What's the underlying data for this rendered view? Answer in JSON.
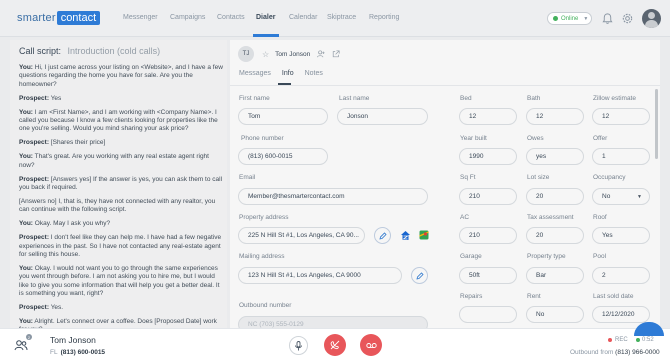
{
  "brand": {
    "part1": "smarter",
    "part2": "contact",
    "accent": "#2e7bd6"
  },
  "nav": {
    "items": [
      "Messenger",
      "Campaigns",
      "Contacts",
      "Dialer",
      "Calendar",
      "Skiptrace",
      "Reporting"
    ],
    "active": "Dialer",
    "status": "Online",
    "icons": [
      "bell-icon",
      "gear-icon",
      "user-avatar"
    ]
  },
  "script": {
    "title": "Call script:",
    "subtitle": "Introduction (cold calls)",
    "paragraphs": [
      {
        "speaker": "You:",
        "text": "Hi, I just came across your listing on <Website>, and I have a few questions regarding the home you have for sale. Are you the homeowner?"
      },
      {
        "speaker": "Prospect:",
        "text": "Yes"
      },
      {
        "speaker": "You:",
        "text": "I am <First Name>, and I am working with <Company Name>. I called you because I know a few clients looking for properties like the one you're selling. Would you mind sharing your ask price?"
      },
      {
        "speaker": "Prospect:",
        "text": "[Shares their price]"
      },
      {
        "speaker": "You:",
        "text": "That's great. Are you working with any real estate agent right now?"
      },
      {
        "speaker": "Prospect:",
        "text": "[Answers yes] If the answer is yes, you can ask them to call you back if required."
      },
      {
        "speaker": "",
        "text": "[Answers no] I, that is, they have not connected with any realtor, you can continue with the following script."
      },
      {
        "speaker": "You:",
        "text": "Okay. May I ask you why?"
      },
      {
        "speaker": "Prospect:",
        "text": "I don't feel like they can help me. I have had a few negative experiences in the past. So I have not contacted any real-estate agent for selling this house."
      },
      {
        "speaker": "You:",
        "text": "Okay. I would not want you to go through the same experiences you went through before. I am not asking you to hire me, but I would like to give you some information that will help you get a better deal. It is something you want, right?"
      },
      {
        "speaker": "Prospect:",
        "text": "Yes."
      },
      {
        "speaker": "You:",
        "text": "Alright. Let's connect over a coffee. Does [Proposed Date] work for you?"
      }
    ]
  },
  "contact": {
    "initials": "TJ",
    "name": "Tom Jonson",
    "tabs": [
      "Messages",
      "Info",
      "Notes"
    ],
    "active_tab": "Info",
    "first_name_label": "First name",
    "first_name": "Tom",
    "last_name_label": "Last name",
    "last_name": "Jonson",
    "phone_label": "Phone number",
    "phone": "(813) 600-0015",
    "email_label": "Email",
    "email": "Member@thesmartercontact.com",
    "property_label": "Property address",
    "property": "225 N Hill St #1, Los Angeles, CA 90...",
    "mailing_label": "Mailing address",
    "mailing": "123 N Hill St #1, Los Angeles, CA 9000",
    "outbound_label": "Outbound number",
    "outbound_placeholder": "NC (703) 555-0129",
    "bed_label": "Bed",
    "bed": "12",
    "bath_label": "Bath",
    "bath": "12",
    "zillow_label": "Zillow estimate",
    "zillow": "12",
    "year_label": "Year built",
    "year": "1990",
    "owes_label": "Owes",
    "owes": "yes",
    "offer_label": "Offer",
    "offer": "1",
    "sqft_label": "Sq Ft",
    "sqft": "210",
    "lot_label": "Lot size",
    "lot": "20",
    "occupancy_label": "Occupancy",
    "occupancy": "No",
    "ac_label": "AC",
    "ac": "210",
    "tax_label": "Tax assessment",
    "tax": "20",
    "roof_label": "Roof",
    "roof": "Yes",
    "garage_label": "Garage",
    "garage": "50ft",
    "ptype_label": "Property type",
    "ptype": "Bar",
    "pool_label": "Pool",
    "pool": "2",
    "repairs_label": "Repairs",
    "repairs": "",
    "rent_label": "Rent",
    "rent": "No",
    "lastsold_label": "Last sold date",
    "lastsold": "12/12/2020"
  },
  "callbar": {
    "badge": "2",
    "name": "Tom Jonson",
    "state": "FL",
    "phone": "(813) 600-0015",
    "rec": "REC",
    "timer": "0:52",
    "outbound_label": "Outbound from",
    "outbound_number": "(813) 966-0000"
  }
}
